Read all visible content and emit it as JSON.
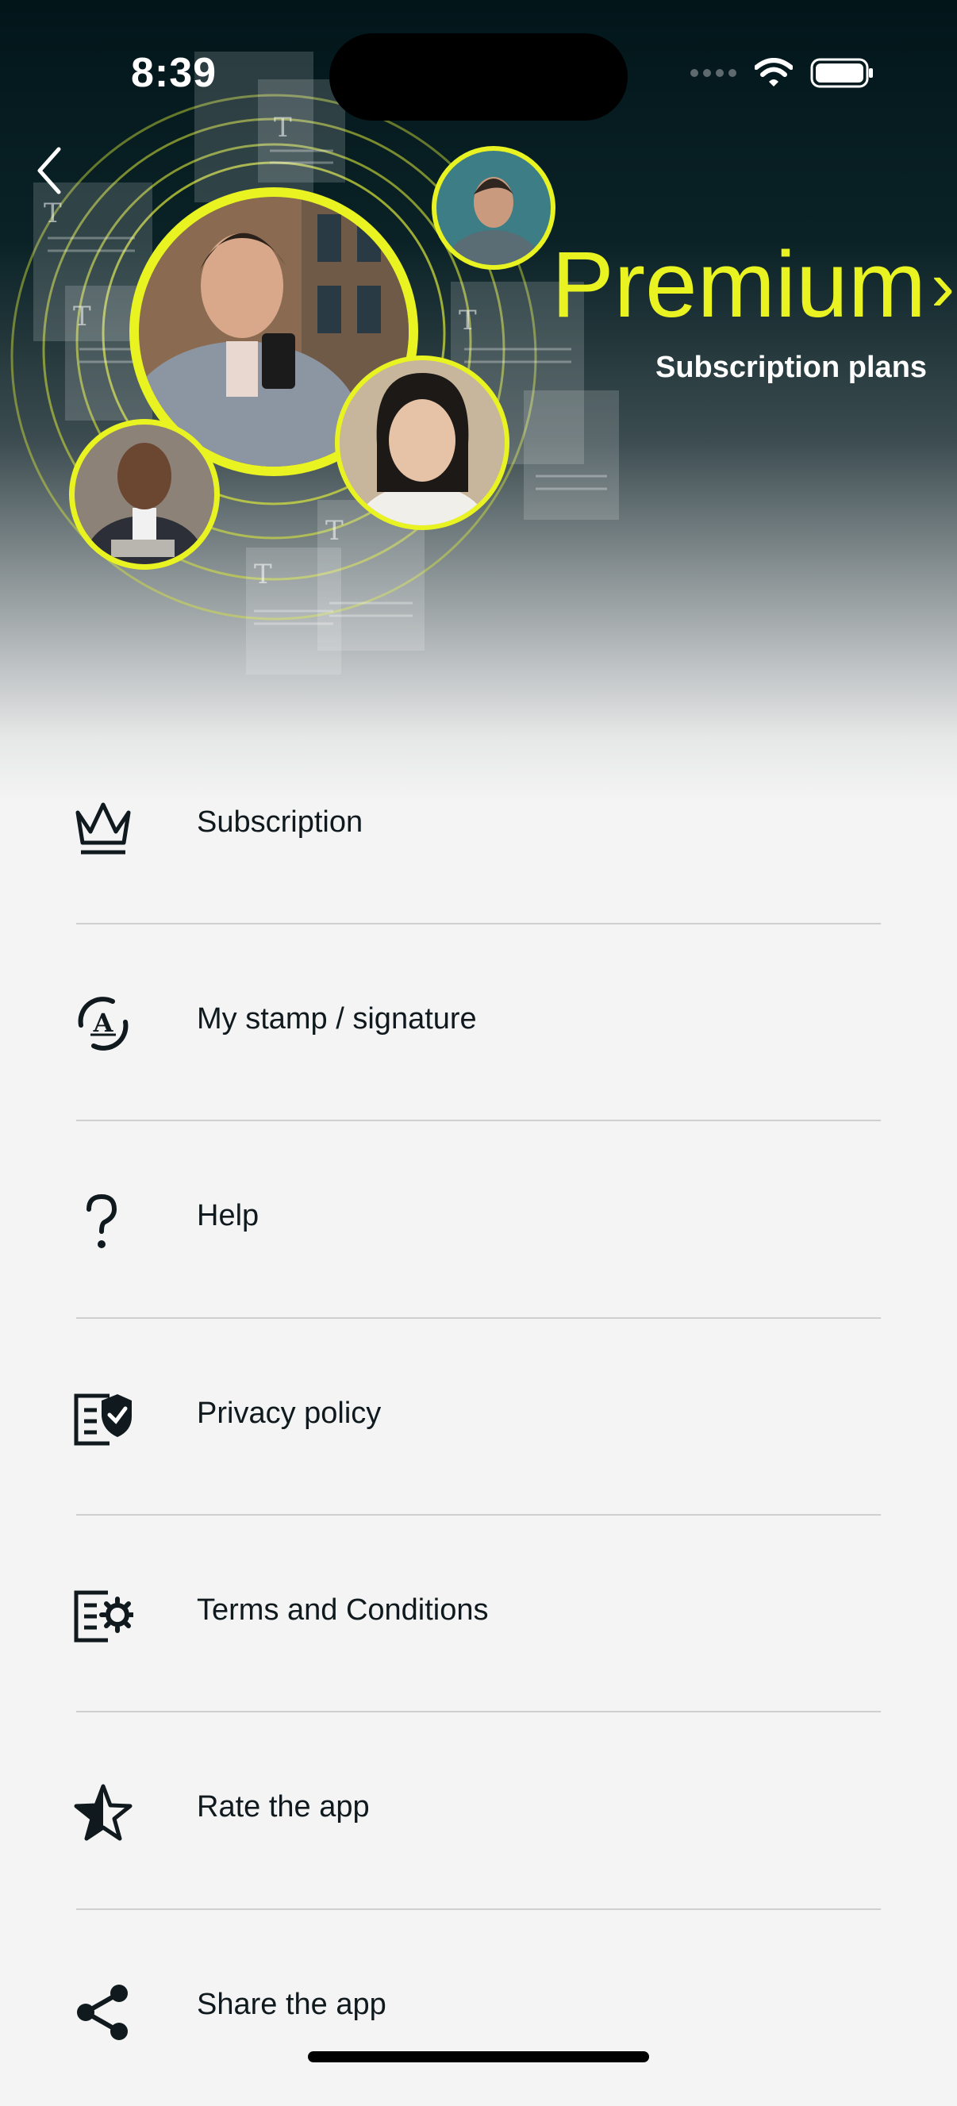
{
  "status_bar": {
    "time": "8:39"
  },
  "header": {
    "premium_title": "Premium",
    "premium_chevron": "›",
    "premium_subtitle": "Subscription plans",
    "back_icon": "chevron-left-icon"
  },
  "colors": {
    "accent": "#e8f321",
    "hero_dark": "#02161a",
    "background": "#f4f4f4",
    "text": "#101a1e"
  },
  "menu": [
    {
      "label": "Subscription",
      "icon": "crown-icon"
    },
    {
      "label": "My stamp / signature",
      "icon": "stamp-signature-icon"
    },
    {
      "label": "Help",
      "icon": "question-icon"
    },
    {
      "label": "Privacy policy",
      "icon": "privacy-shield-icon"
    },
    {
      "label": "Terms and Conditions",
      "icon": "terms-gear-icon"
    },
    {
      "label": "Rate the app",
      "icon": "star-icon"
    },
    {
      "label": "Share the app",
      "icon": "share-icon"
    }
  ]
}
